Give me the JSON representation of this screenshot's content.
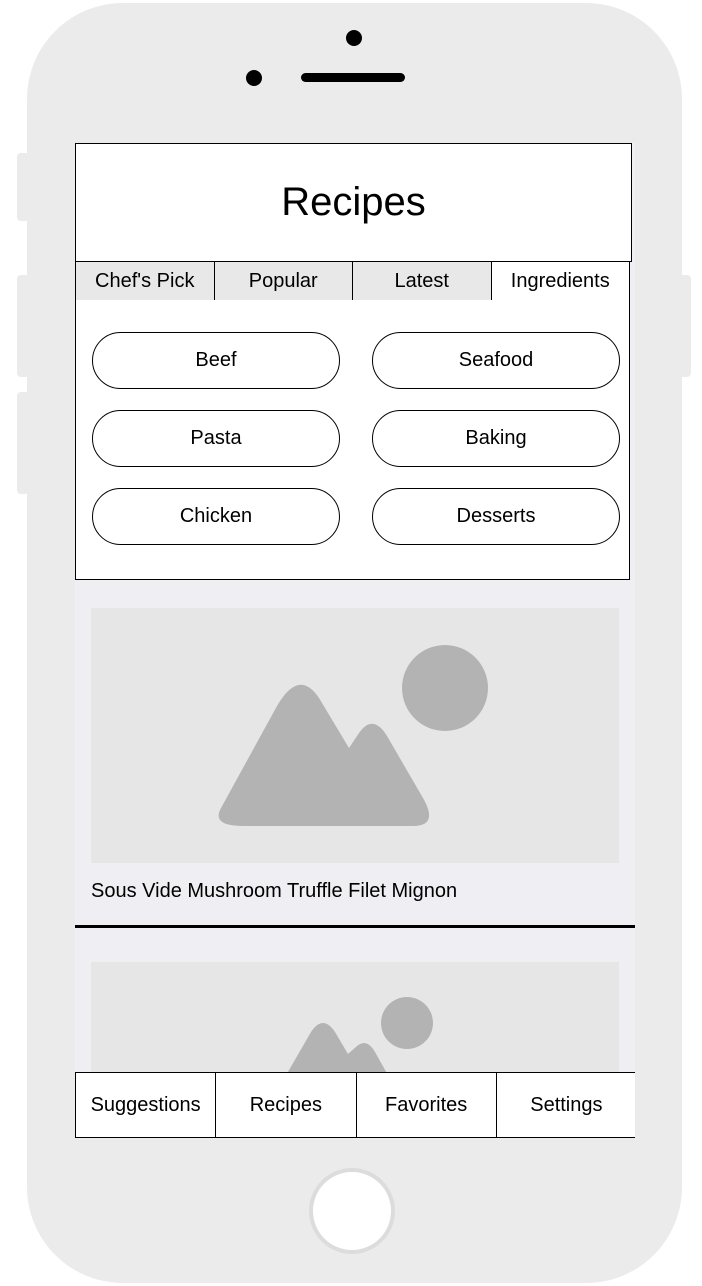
{
  "header": {
    "title": "Recipes"
  },
  "tabs": [
    {
      "label": "Chef's Pick",
      "active": false
    },
    {
      "label": "Popular",
      "active": false
    },
    {
      "label": "Latest",
      "active": false
    },
    {
      "label": "Ingredients",
      "active": true
    }
  ],
  "categories": [
    "Beef",
    "Seafood",
    "Pasta",
    "Baking",
    "Chicken",
    "Desserts"
  ],
  "cards": [
    {
      "title": "Sous Vide Mushroom Truffle Filet Mignon",
      "image_icon": "image-placeholder-icon"
    },
    {
      "title": "",
      "image_icon": "image-placeholder-icon"
    }
  ],
  "bottom_nav": [
    {
      "label": "Suggestions"
    },
    {
      "label": "Recipes"
    },
    {
      "label": "Favorites"
    },
    {
      "label": "Settings"
    }
  ],
  "colors": {
    "frame": "#ebebeb",
    "screen_bg": "#efeff3",
    "placeholder": "#e6e6e6",
    "placeholder_shape": "#b3b3b3"
  }
}
